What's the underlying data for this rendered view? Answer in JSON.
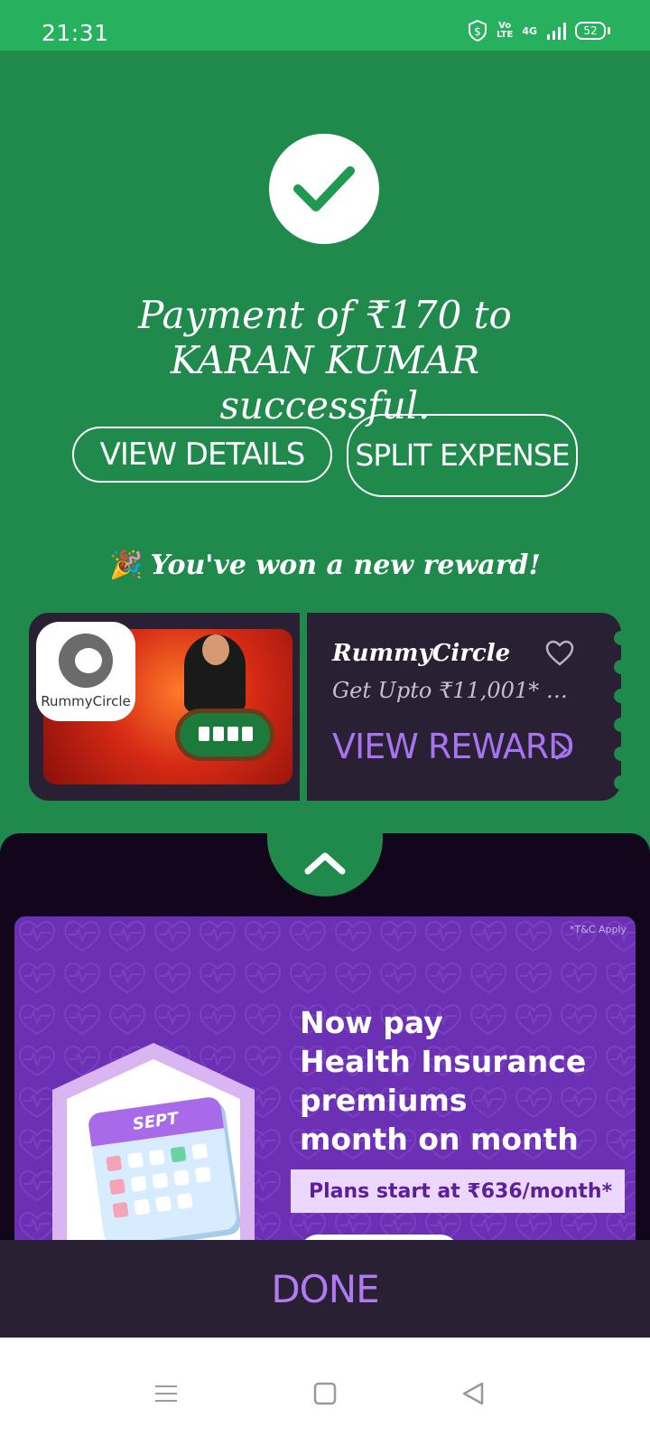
{
  "status_bar": {
    "time": "21:31",
    "volte_line1": "Vo",
    "volte_line2": "LTE",
    "network": "4G",
    "battery": "52"
  },
  "payment": {
    "title": "Payment of ₹170 to KARAN KUMAR successful.",
    "status_icon": "check-icon",
    "accent_color": "#1f8a4c"
  },
  "actions": {
    "view_details": "VIEW DETAILS",
    "split_expense": "SPLIT EXPENSE"
  },
  "reward": {
    "headline": "You've won a new reward!",
    "headline_icon": "party-popper-icon",
    "brand_name": "RummyCircle",
    "logo_text": "RummyCircle",
    "offer": "Get Upto ₹11,001* W...",
    "cta": "VIEW REWARD",
    "favorite_icon": "heart-outline-icon"
  },
  "promo": {
    "tnc": "*T&C Apply",
    "headline_lines": [
      "Now pay",
      "Health Insurance",
      "premiums",
      "month on month"
    ],
    "chip": "Plans start at ₹636/month*",
    "calendar_label": "SEPT"
  },
  "footer": {
    "done": "DONE"
  },
  "nav": {
    "menu_icon": "menu-icon",
    "home_icon": "home-square-icon",
    "back_icon": "back-triangle-icon"
  }
}
